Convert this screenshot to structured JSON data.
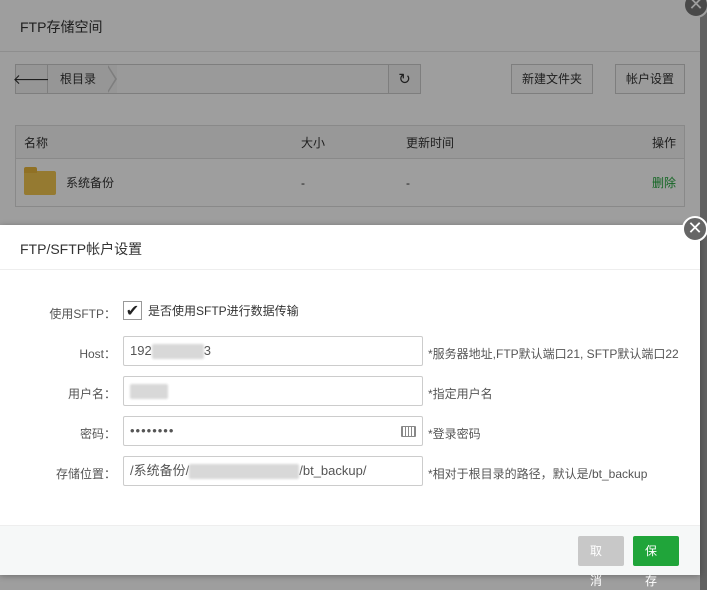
{
  "bg": {
    "title": "FTP存储空间",
    "path": {
      "root_label": "根目录"
    },
    "toolbar": {
      "new_folder_label": "新建文件夹",
      "account_settings_label": "帐户设置"
    },
    "table": {
      "headers": {
        "name": "名称",
        "size": "大小",
        "updated": "更新时间",
        "actions": "操作"
      },
      "rows": [
        {
          "name": "系统备份",
          "size": "-",
          "updated": "-",
          "action": "删除"
        }
      ]
    },
    "close_glyph": "✕"
  },
  "modal": {
    "title": "FTP/SFTP帐户设置",
    "close_glyph": "✕",
    "fields": {
      "sftp": {
        "label": "使用SFTP：",
        "checked": true,
        "check_text": "是否使用SFTP进行数据传输"
      },
      "host": {
        "label": "Host：",
        "value_prefix": "192",
        "value_suffix": "3",
        "hint": "*服务器地址,FTP默认端口21, SFTP默认端口22"
      },
      "username": {
        "label": "用户名：",
        "hint": "*指定用户名"
      },
      "password": {
        "label": "密码：",
        "value": "••••••••",
        "hint": "*登录密码"
      },
      "storage": {
        "label": "存储位置：",
        "value_prefix": "/系统备份/",
        "value_suffix": "/bt_backup/",
        "hint": "*相对于根目录的路径，默认是/bt_backup"
      }
    },
    "footer": {
      "cancel_label": "取消",
      "save_label": "保存"
    }
  },
  "colors": {
    "accent_green": "#20a53a",
    "cancel_gray": "#c8c8c8",
    "folder_yellow": "#f0c64f"
  },
  "icons": {
    "back": "arrow-left-icon",
    "refresh": "refresh-icon",
    "folder": "folder-icon",
    "close": "close-icon",
    "keyboard": "keyboard-icon",
    "checkmark": "checkmark-icon"
  }
}
